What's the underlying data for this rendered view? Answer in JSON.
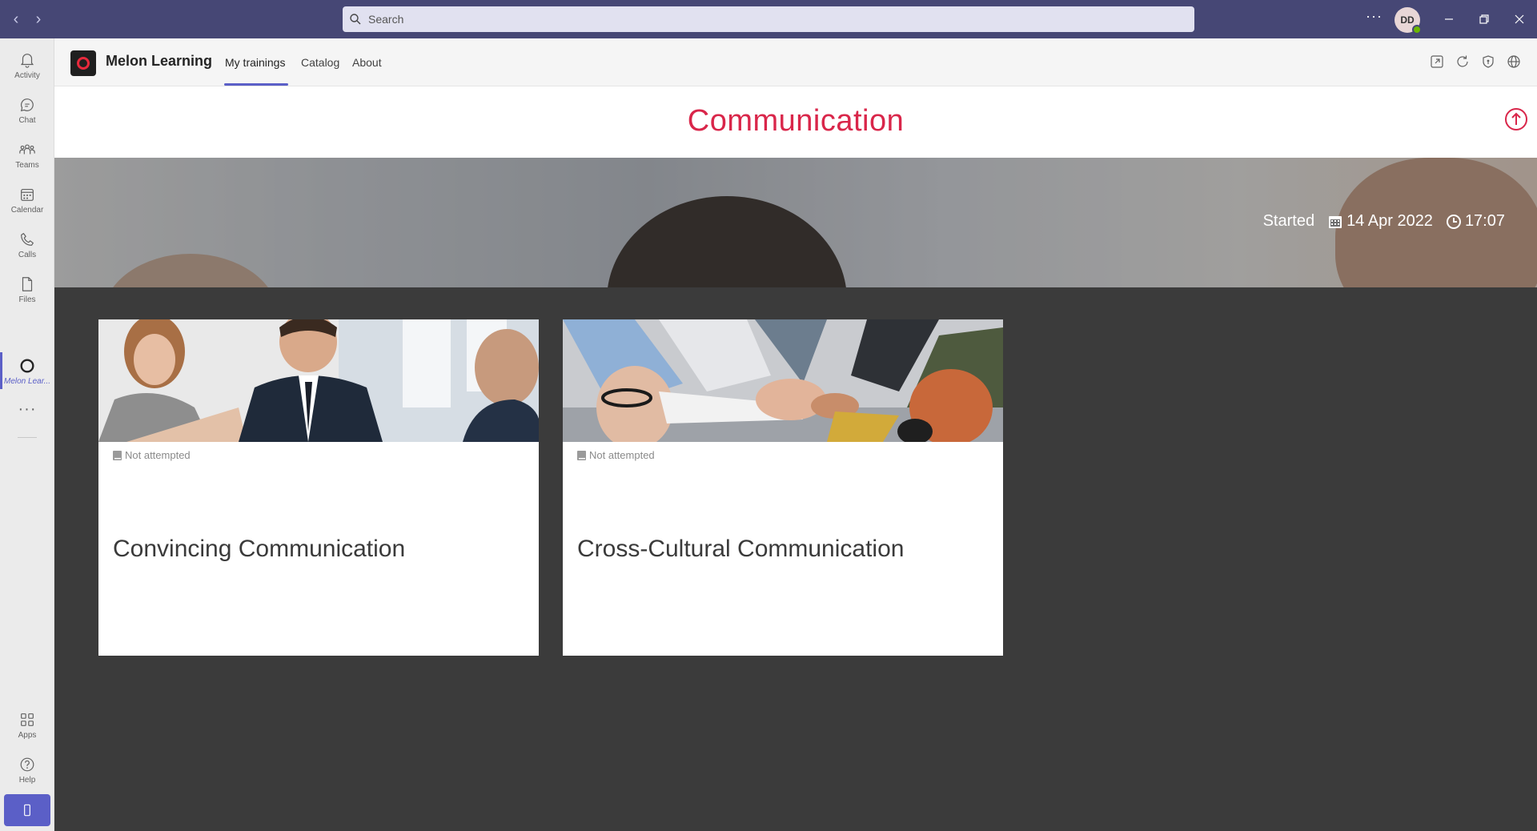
{
  "titlebar": {
    "search_placeholder": "Search",
    "more_label": "···",
    "avatar_initials": "DD"
  },
  "rail": {
    "items": [
      {
        "label": "Activity",
        "icon": "bell-icon"
      },
      {
        "label": "Chat",
        "icon": "chat-icon"
      },
      {
        "label": "Teams",
        "icon": "teams-icon"
      },
      {
        "label": "Calendar",
        "icon": "calendar-icon"
      },
      {
        "label": "Calls",
        "icon": "phone-icon"
      },
      {
        "label": "Files",
        "icon": "file-icon"
      },
      {
        "label": "Melon Lear...",
        "icon": "melon-ring-icon"
      }
    ],
    "more_label": "···",
    "bottom_items": [
      {
        "label": "Apps",
        "icon": "apps-grid-icon"
      },
      {
        "label": "Help",
        "icon": "help-icon"
      }
    ]
  },
  "app": {
    "name": "Melon Learning",
    "tabs": [
      "My trainings",
      "Catalog",
      "About"
    ],
    "active_tab": "My trainings"
  },
  "page": {
    "title": "Communication",
    "started_label": "Started",
    "started_date": "14 Apr 2022",
    "started_time": "17:07"
  },
  "cards": [
    {
      "status": "Not attempted",
      "title": "Convincing Communication"
    },
    {
      "status": "Not attempted",
      "title": "Cross-Cultural Communication"
    }
  ],
  "colors": {
    "titlebar": "#464775",
    "accent": "#5b5fc7",
    "title_red": "#d9264a",
    "background": "#3b3b3b"
  }
}
